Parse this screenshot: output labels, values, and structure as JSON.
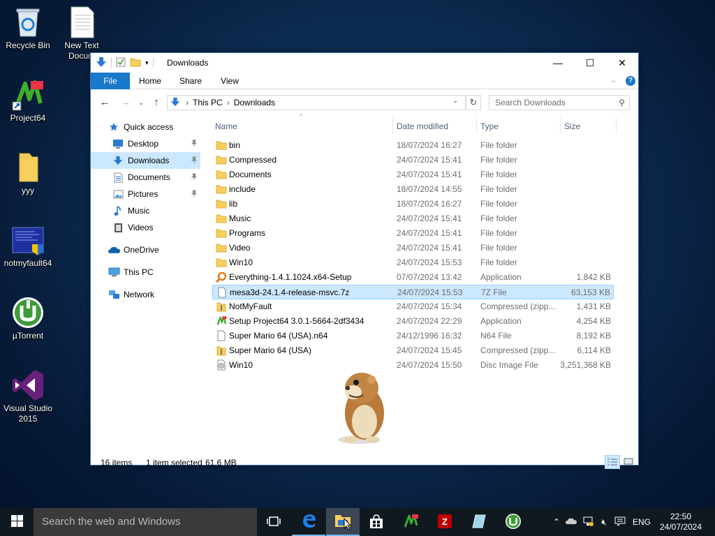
{
  "desktop": {
    "icons": [
      {
        "label": "Recycle Bin",
        "icon": "recycle-bin-icon"
      },
      {
        "label": "New Text Docum",
        "icon": "text-document-icon"
      },
      {
        "label": "Project64",
        "icon": "project64-icon"
      },
      {
        "label": "yyy",
        "icon": "folder-icon"
      },
      {
        "label": "notmyfault64",
        "icon": "notmyfault-icon"
      },
      {
        "label": "µTorrent",
        "icon": "utorrent-icon"
      },
      {
        "label": "Visual Studio 2015",
        "icon": "visual-studio-icon"
      }
    ]
  },
  "explorer": {
    "title": "Downloads",
    "window_buttons": {
      "minimize": "—",
      "maximize": "☐",
      "close": "✕"
    },
    "ribbon_tabs": [
      "File",
      "Home",
      "Share",
      "View"
    ],
    "breadcrumb": [
      "This PC",
      "Downloads"
    ],
    "search_placeholder": "Search Downloads",
    "nav_pane": [
      {
        "label": "Quick access",
        "icon": "star-icon"
      },
      {
        "label": "Desktop",
        "icon": "desktop-icon",
        "pinned": true
      },
      {
        "label": "Downloads",
        "icon": "download-arrow-icon",
        "pinned": true,
        "selected": true
      },
      {
        "label": "Documents",
        "icon": "documents-icon",
        "pinned": true
      },
      {
        "label": "Pictures",
        "icon": "pictures-icon",
        "pinned": true
      },
      {
        "label": "Music",
        "icon": "music-icon"
      },
      {
        "label": "Videos",
        "icon": "videos-icon"
      },
      {
        "label": "OneDrive",
        "icon": "onedrive-icon"
      },
      {
        "label": "This PC",
        "icon": "computer-icon"
      },
      {
        "label": "Network",
        "icon": "network-icon"
      }
    ],
    "columns": [
      "Name",
      "Date modified",
      "Type",
      "Size"
    ],
    "files": [
      {
        "name": "bin",
        "date": "18/07/2024 16:27",
        "type": "File folder",
        "size": "",
        "icon": "folder"
      },
      {
        "name": "Compressed",
        "date": "24/07/2024 15:41",
        "type": "File folder",
        "size": "",
        "icon": "folder"
      },
      {
        "name": "Documents",
        "date": "24/07/2024 15:41",
        "type": "File folder",
        "size": "",
        "icon": "folder"
      },
      {
        "name": "include",
        "date": "18/07/2024 14:55",
        "type": "File folder",
        "size": "",
        "icon": "folder"
      },
      {
        "name": "lib",
        "date": "18/07/2024 16:27",
        "type": "File folder",
        "size": "",
        "icon": "folder"
      },
      {
        "name": "Music",
        "date": "24/07/2024 15:41",
        "type": "File folder",
        "size": "",
        "icon": "folder"
      },
      {
        "name": "Programs",
        "date": "24/07/2024 15:41",
        "type": "File folder",
        "size": "",
        "icon": "folder"
      },
      {
        "name": "Video",
        "date": "24/07/2024 15:41",
        "type": "File folder",
        "size": "",
        "icon": "folder"
      },
      {
        "name": "Win10",
        "date": "24/07/2024 15:53",
        "type": "File folder",
        "size": "",
        "icon": "folder"
      },
      {
        "name": "Everything-1.4.1.1024.x64-Setup",
        "date": "07/07/2024 13:42",
        "type": "Application",
        "size": "1,842 KB",
        "icon": "search-app"
      },
      {
        "name": "mesa3d-24.1.4-release-msvc.7z",
        "date": "24/07/2024 15:53",
        "type": "7Z File",
        "size": "63,153 KB",
        "icon": "blank-file",
        "selected": true
      },
      {
        "name": "NotMyFault",
        "date": "24/07/2024 15:34",
        "type": "Compressed (zipp...",
        "size": "1,431 KB",
        "icon": "zip"
      },
      {
        "name": "Setup Project64 3.0.1-5664-2df3434",
        "date": "24/07/2024 22:29",
        "type": "Application",
        "size": "4,254 KB",
        "icon": "project64"
      },
      {
        "name": "Super Mario 64 (USA).n64",
        "date": "24/12/1996 16:32",
        "type": "N64 File",
        "size": "8,192 KB",
        "icon": "blank-file"
      },
      {
        "name": "Super Mario 64 (USA)",
        "date": "24/07/2024 15:45",
        "type": "Compressed (zipp...",
        "size": "6,114 KB",
        "icon": "zip"
      },
      {
        "name": "Win10",
        "date": "24/07/2024 15:50",
        "type": "Disc Image File",
        "size": "3,251,368 KB",
        "icon": "disc"
      }
    ],
    "status": {
      "items": "16 items",
      "selected": "1 item selected",
      "size": "61.6 MB"
    }
  },
  "taskbar": {
    "search_placeholder": "Search the web and Windows",
    "language": "ENG",
    "time": "22:50",
    "date": "24/07/2024"
  },
  "colors": {
    "accent": "#1979ca",
    "selection": "#cce8ff",
    "taskbar": "#101820"
  }
}
